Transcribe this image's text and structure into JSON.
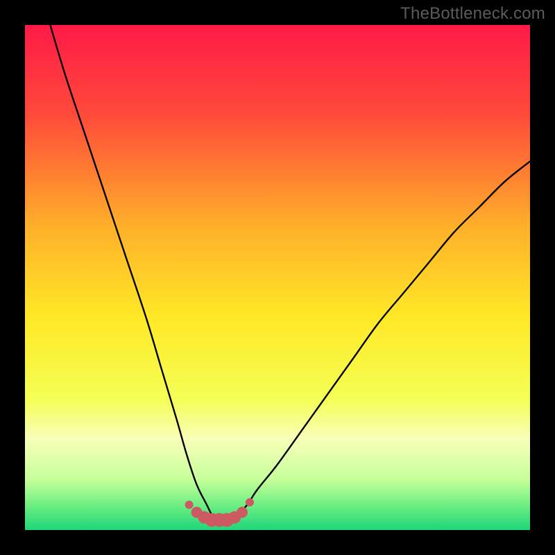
{
  "watermark": "TheBottleneck.com",
  "colors": {
    "frame": "#000000",
    "curve_stroke": "#000000",
    "marker_fill": "#cc5a63",
    "gradient_stops": [
      {
        "pct": 0,
        "color": "#ff1a47"
      },
      {
        "pct": 18,
        "color": "#ff4b3a"
      },
      {
        "pct": 40,
        "color": "#ffb02a"
      },
      {
        "pct": 58,
        "color": "#ffe926"
      },
      {
        "pct": 74,
        "color": "#f4ff55"
      },
      {
        "pct": 82,
        "color": "#f8ffb8"
      },
      {
        "pct": 90,
        "color": "#c6ff9a"
      },
      {
        "pct": 95,
        "color": "#6fef82"
      },
      {
        "pct": 100,
        "color": "#1fd67a"
      }
    ]
  },
  "chart_data": {
    "type": "line",
    "title": "",
    "xlabel": "",
    "ylabel": "",
    "xlim": [
      0,
      100
    ],
    "ylim": [
      0,
      100
    ],
    "grid": false,
    "legend": false,
    "series": [
      {
        "name": "bottleneck-curve",
        "x": [
          5,
          8,
          12,
          16,
          20,
          24,
          27,
          30,
          32,
          34,
          36,
          37,
          38,
          39,
          40,
          42,
          44,
          46,
          50,
          55,
          60,
          65,
          70,
          75,
          80,
          85,
          90,
          95,
          100
        ],
        "y": [
          100,
          90,
          78,
          66,
          54,
          42,
          32,
          22,
          15,
          9,
          5,
          3,
          2,
          2,
          2,
          3,
          5,
          8,
          13,
          20,
          27,
          34,
          41,
          47,
          53,
          59,
          64,
          69,
          73
        ]
      }
    ],
    "markers": {
      "name": "near-minimum-dots",
      "x": [
        32.5,
        34.0,
        35.5,
        37.0,
        38.5,
        40.0,
        41.5,
        43.0,
        44.5
      ],
      "y": [
        5.0,
        3.5,
        2.5,
        2.0,
        2.0,
        2.0,
        2.5,
        3.5,
        5.5
      ],
      "r": [
        6,
        8,
        9,
        10,
        10,
        10,
        9,
        8,
        6
      ]
    }
  }
}
